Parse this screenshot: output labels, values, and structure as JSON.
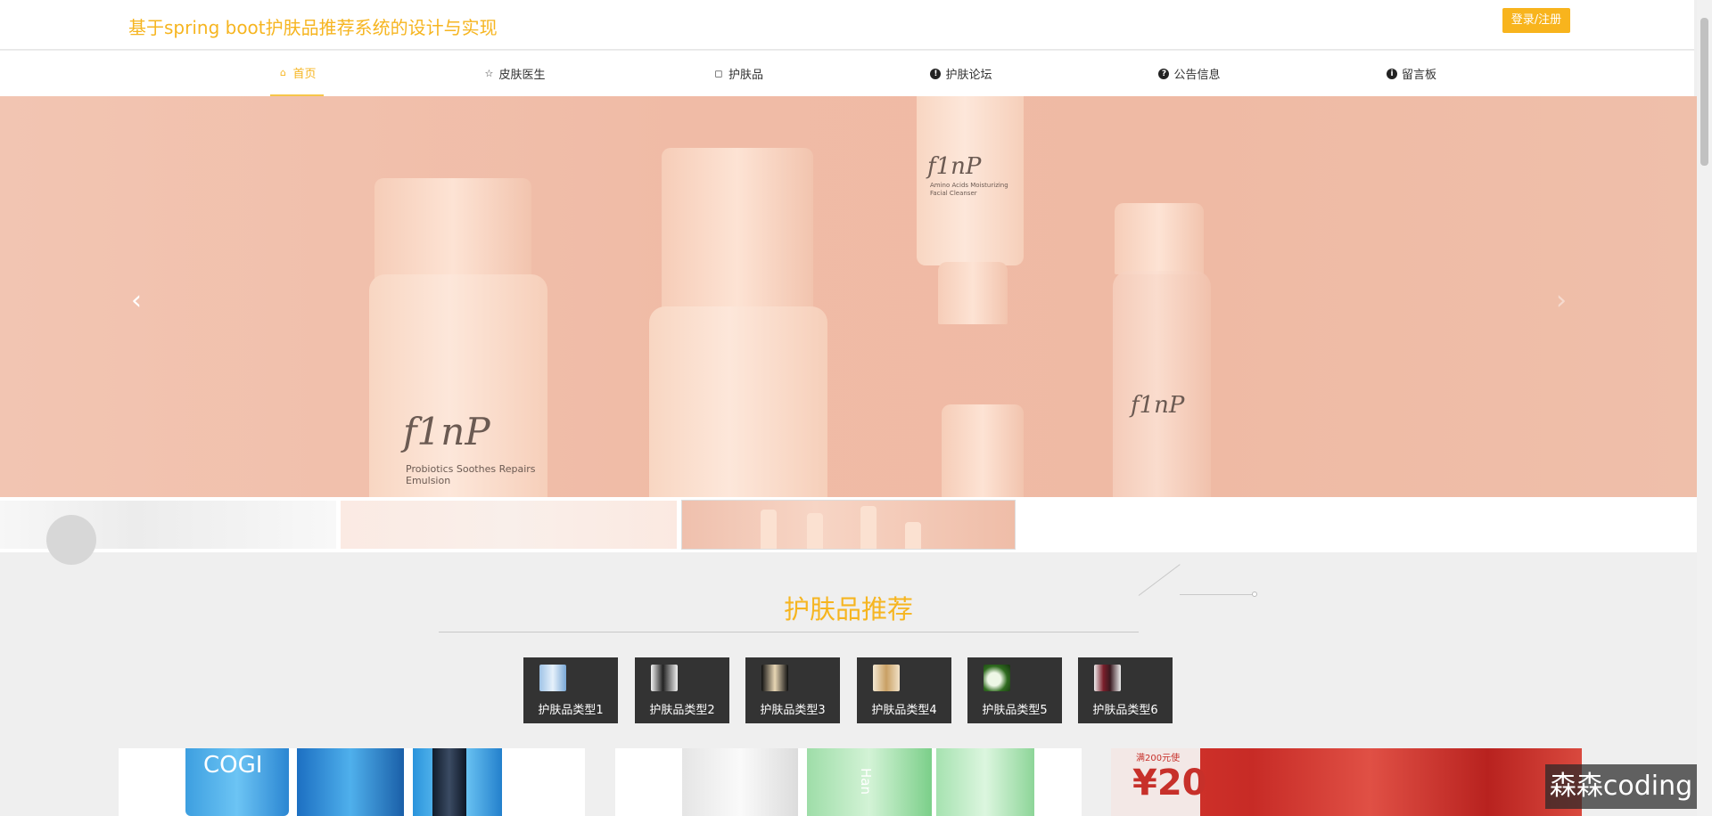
{
  "header": {
    "site_title": "基于spring boot护肤品推荐系统的设计与实现",
    "login_label": "登录/注册"
  },
  "nav": {
    "items": [
      {
        "label": "首页",
        "icon": "home-icon",
        "active": true
      },
      {
        "label": "皮肤医生",
        "icon": "star-icon",
        "active": false
      },
      {
        "label": "护肤品",
        "icon": "bag-icon",
        "active": false
      },
      {
        "label": "护肤论坛",
        "icon": "info-icon",
        "active": false
      },
      {
        "label": "公告信息",
        "icon": "question-icon",
        "active": false
      },
      {
        "label": "留言板",
        "icon": "info-circle-icon",
        "active": false
      }
    ]
  },
  "banner": {
    "brand": "f1nP",
    "caption_line1": "Probiotics Soothes Repairs",
    "caption_line2": "Emulsion",
    "tube_caption": "Amino Acids Moisturizing Facial Cleanser",
    "prev_icon": "chevron-left-icon",
    "next_icon": "chevron-right-icon"
  },
  "section": {
    "title": "护肤品推荐"
  },
  "categories": [
    {
      "label": "护肤品类型1"
    },
    {
      "label": "护肤品类型2"
    },
    {
      "label": "护肤品类型3"
    },
    {
      "label": "护肤品类型4"
    },
    {
      "label": "护肤品类型5"
    },
    {
      "label": "护肤品类型6"
    }
  ],
  "products": {
    "card1_brand": "COGI",
    "card2_brand": "Han",
    "card3_promo": "满200元使",
    "card3_price": "¥20"
  },
  "watermark": "森森coding",
  "colors": {
    "accent": "#f6b520",
    "button": "#f8b41d",
    "category_bg": "#333333",
    "banner_bg": "#f0bba6"
  }
}
